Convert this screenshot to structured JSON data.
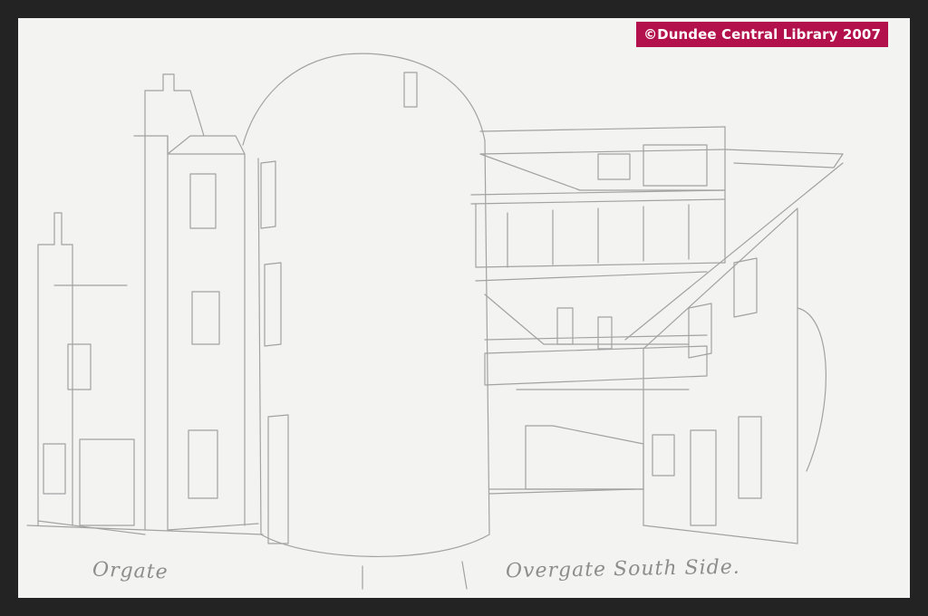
{
  "image": {
    "description_type": "pencil-sketch",
    "watermark": {
      "text": "©Dundee Central Library 2007",
      "color": "#b3114c"
    },
    "captions": [
      {
        "name": "left-caption",
        "text": "Orgate"
      },
      {
        "name": "right-caption",
        "text": "Overgate South Side."
      }
    ],
    "colors": {
      "background": "#232323",
      "paper": "#f3f3f1",
      "pencil": "#9a9a9a"
    }
  }
}
